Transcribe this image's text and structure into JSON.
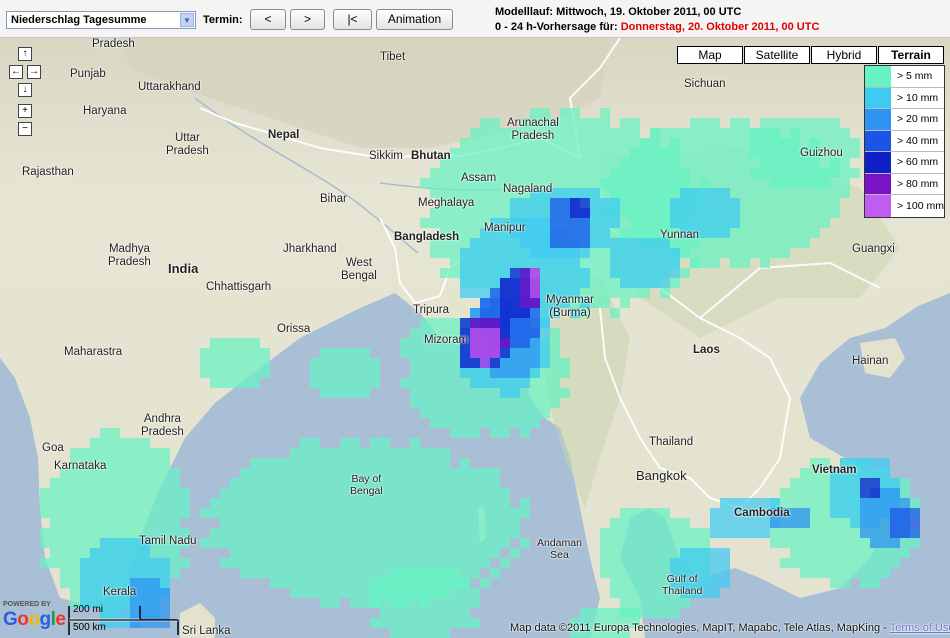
{
  "toolbar": {
    "product_select": "Niederschlag Tagesumme",
    "termin_label": "Termin:",
    "btn_prev": "<",
    "btn_next": ">",
    "btn_first": "|<",
    "btn_animation": "Animation",
    "modelllauf": "Modelllauf: Mittwoch, 19. Oktober 2011, 00 UTC",
    "vorhersage_prefix": "0 - 24 h-Vorhersage für: ",
    "vorhersage_date": "Donnerstag, 20. Oktober 2011, 00 UTC"
  },
  "map_types": {
    "map": "Map",
    "satellite": "Satellite",
    "hybrid": "Hybrid",
    "terrain": "Terrain",
    "active": "terrain"
  },
  "legend": [
    {
      "label": "> 5 mm",
      "color": "#66f2c4"
    },
    {
      "label": "> 10 mm",
      "color": "#3ecaf1"
    },
    {
      "label": "> 20 mm",
      "color": "#2e93f2"
    },
    {
      "label": "> 40 mm",
      "color": "#1a55e8"
    },
    {
      "label": "> 60 mm",
      "color": "#0f20c8"
    },
    {
      "label": "> 80 mm",
      "color": "#7a12c8"
    },
    {
      "label": "> 100 mm",
      "color": "#c05cf2"
    }
  ],
  "labels": {
    "pradesh_top": "Pradesh",
    "tibet": "Tibet",
    "punjab": "Punjab",
    "uttarakhand": "Uttarakhand",
    "haryana": "Haryana",
    "uttar_pradesh_1": "Uttar",
    "uttar_pradesh_2": "Pradesh",
    "nepal": "Nepal",
    "sikkim": "Sikkim",
    "bhutan": "Bhutan",
    "arunachal_1": "Arunachal",
    "arunachal_2": "Pradesh",
    "sichuan": "Sichuan",
    "rajasthan": "Rajasthan",
    "bihar": "Bihar",
    "assam": "Assam",
    "nagaland": "Nagaland",
    "meghalaya": "Meghalaya",
    "guizhou": "Guizhou",
    "bangladesh": "Bangladesh",
    "manipur": "Manipur",
    "jharkhand": "Jharkhand",
    "yunnan": "Yunnan",
    "guangxi": "Guangxi",
    "madhya_1": "Madhya",
    "madhya_2": "Pradesh",
    "india": "India",
    "west_bengal_1": "West",
    "west_bengal_2": "Bengal",
    "chhattisgarh": "Chhattisgarh",
    "tripura": "Tripura",
    "myanmar_1": "Myanmar",
    "myanmar_2": "(Burma)",
    "orissa": "Orissa",
    "mizoram": "Mizoram",
    "maharastra": "Maharastra",
    "laos": "Laos",
    "hainan": "Hainan",
    "andhra_1": "Andhra",
    "andhra_2": "Pradesh",
    "thailand": "Thailand",
    "goa": "Goa",
    "karnataka": "Karnataka",
    "vietnam": "Vietnam",
    "bangkok": "Bangkok",
    "bay_1": "Bay of",
    "bay_2": "Bengal",
    "cambodia": "Cambodia",
    "tamil_nadu": "Tamil Nadu",
    "andaman_1": "Andaman",
    "andaman_2": "Sea",
    "gulf_1": "Gulf of",
    "gulf_2": "Thailand",
    "kerala": "Kerala",
    "sri_lanka": "Sri Lanka"
  },
  "nav": {
    "up": "↑",
    "left": "←",
    "right": "→",
    "down": "↓",
    "zoom_in": "+",
    "zoom_out": "−"
  },
  "footer": {
    "powered_by": "POWERED BY",
    "google": "Google",
    "scale_mi": "200 mi",
    "scale_km": "500 km",
    "attribution": "Map data ©2011 Europa Technologies, MapIT, Mapabc, Tele Atlas, MapKing - ",
    "terms": "Terms of Use"
  }
}
